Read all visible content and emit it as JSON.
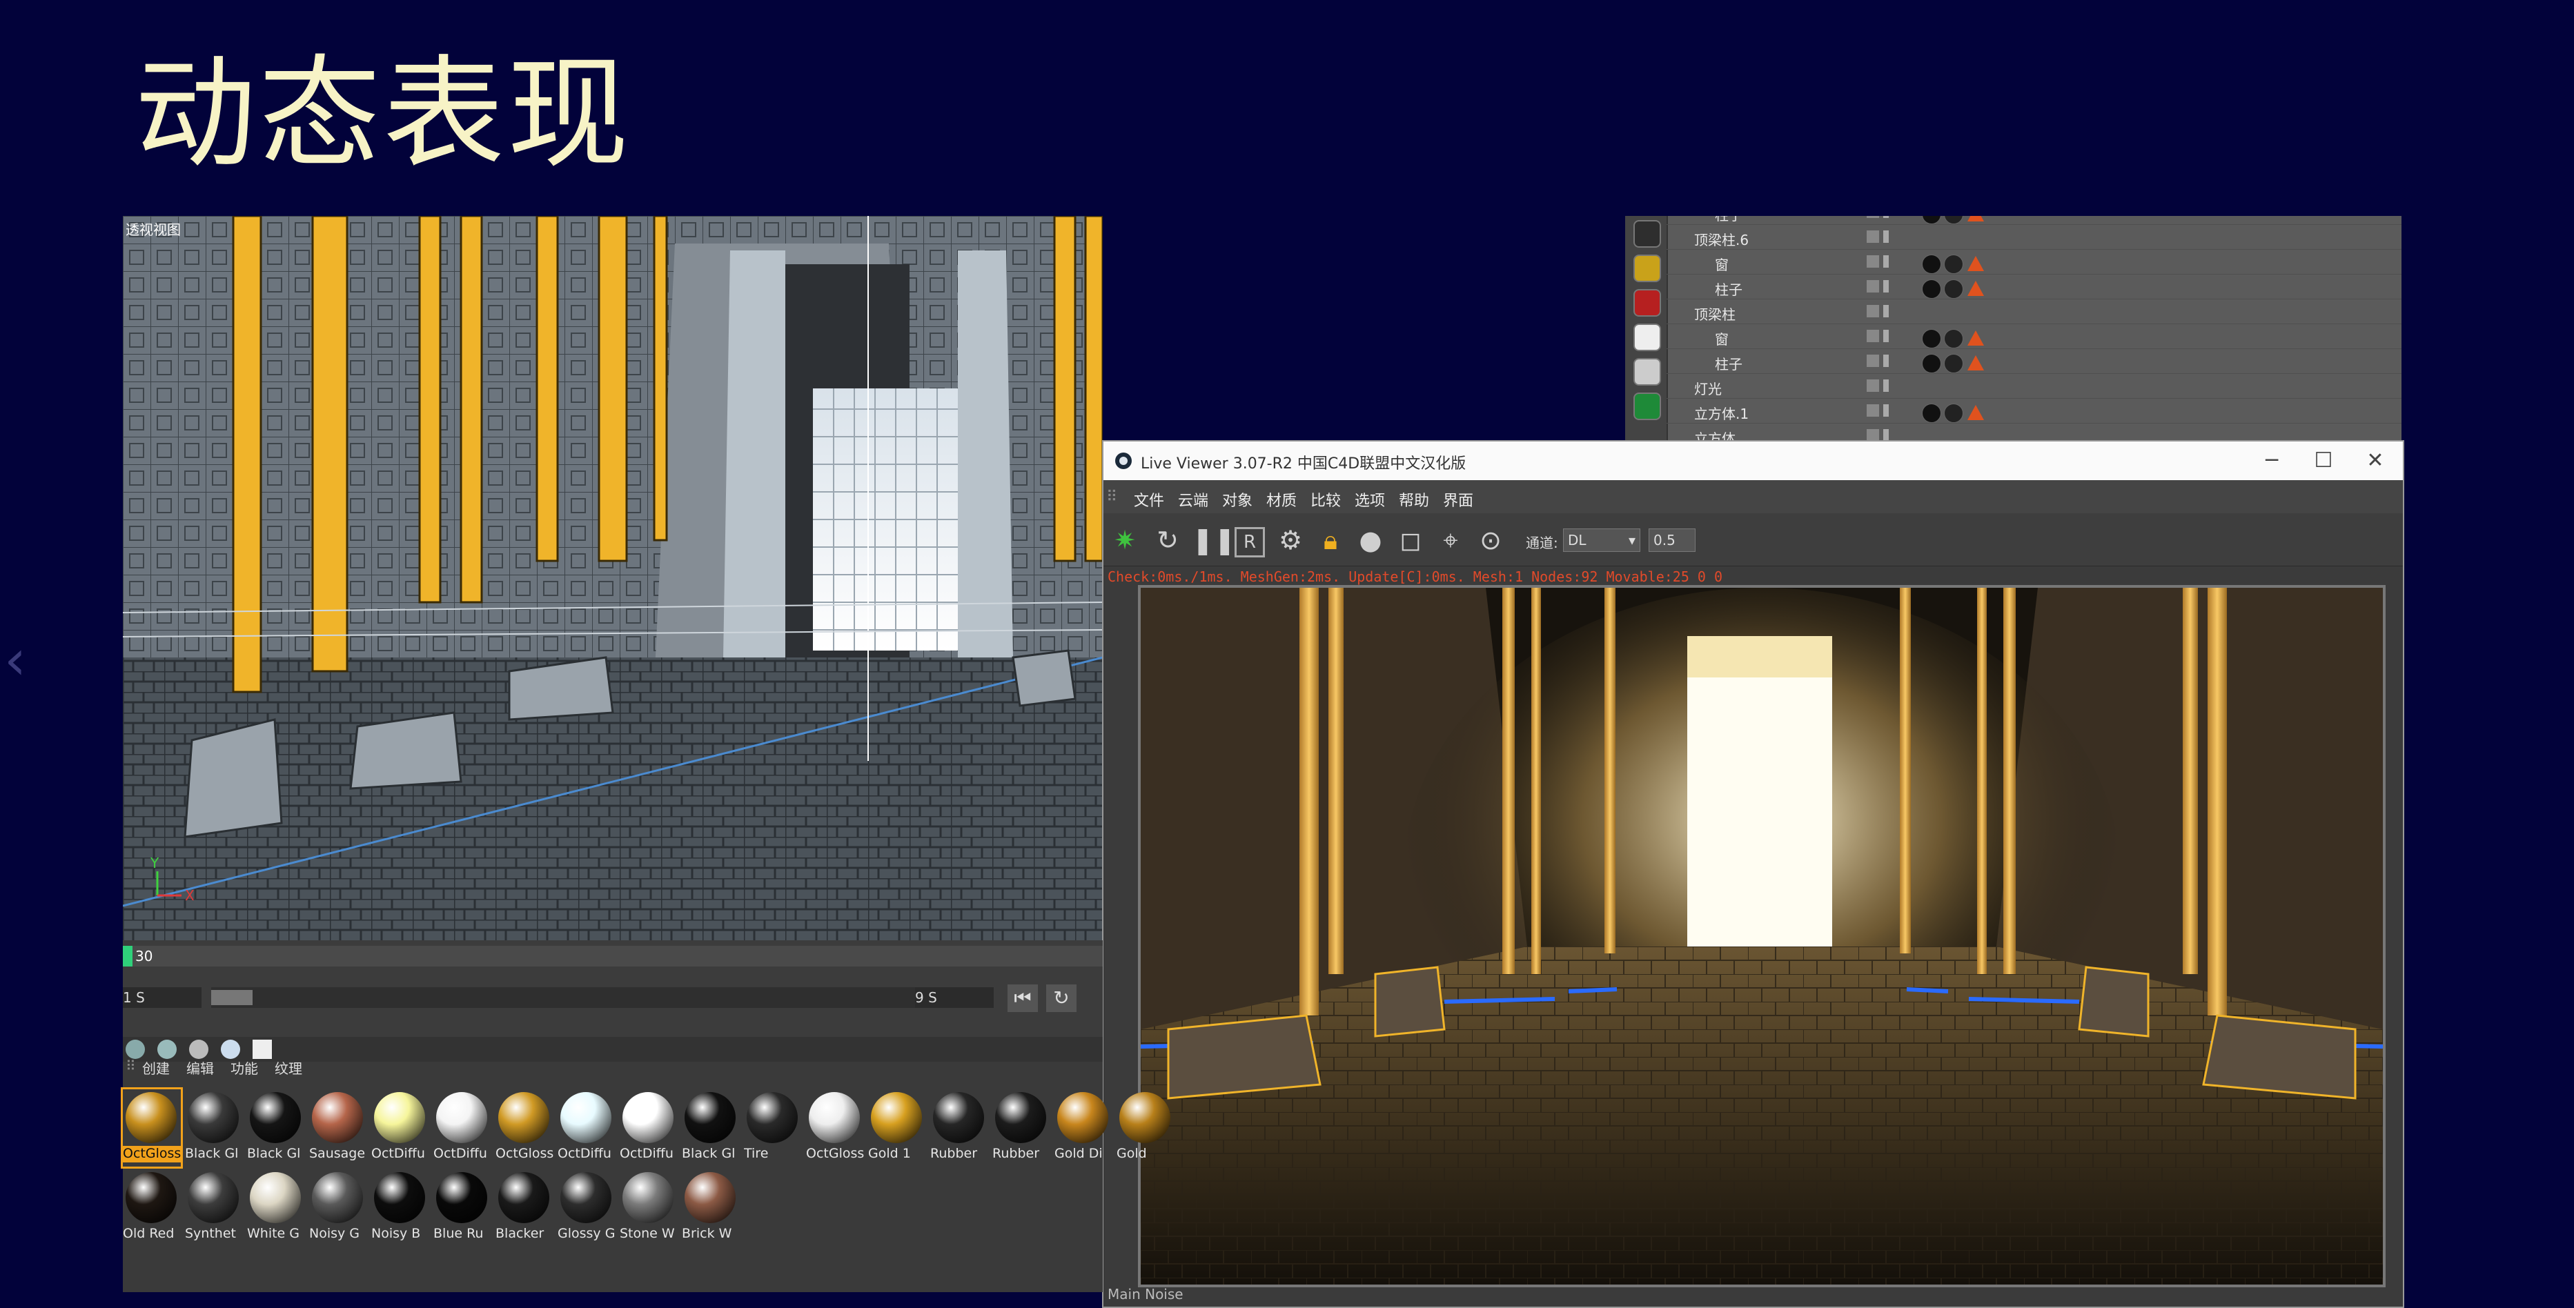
{
  "slide": {
    "title": "动态表现",
    "prev_arrow": "‹"
  },
  "viewport": {
    "label": "透视视图",
    "axis_y": "Y",
    "axis_x": "X"
  },
  "object_manager": {
    "rows": [
      {
        "indent": 1,
        "name": "柱子",
        "has_tags": true
      },
      {
        "indent": 0,
        "name": "顶梁柱.6",
        "has_tags": false
      },
      {
        "indent": 1,
        "name": "窗",
        "has_tags": true
      },
      {
        "indent": 1,
        "name": "柱子",
        "has_tags": true
      },
      {
        "indent": 0,
        "name": "顶梁柱",
        "has_tags": false
      },
      {
        "indent": 1,
        "name": "窗",
        "has_tags": true
      },
      {
        "indent": 1,
        "name": "柱子",
        "has_tags": true
      },
      {
        "indent": 0,
        "name": "灯光",
        "has_tags": false
      },
      {
        "indent": 0,
        "name": "立方体.1",
        "has_tags": true
      },
      {
        "indent": 0,
        "name": "立方体",
        "has_tags": false
      }
    ]
  },
  "live_viewer": {
    "title": "Live Viewer 3.07-R2 中国C4D联盟中文汉化版",
    "window_buttons": {
      "minimize": "─",
      "maximize": "☐",
      "close": "✕"
    },
    "menu": [
      "文件",
      "云端",
      "对象",
      "材质",
      "比较",
      "选项",
      "帮助",
      "界面"
    ],
    "channel_label": "通道:",
    "channel_value": "DL",
    "channel_factor": "0.5",
    "status": "Check:0ms./1ms. MeshGen:2ms. Update[C]:0ms. Mesh:1 Nodes:92 Movable:25  0 0",
    "bottom_status": "Main Noise"
  },
  "timeline": {
    "current_frame": "30",
    "start_value": "1 S",
    "end_value": "9 S"
  },
  "material_manager": {
    "tabs": [
      "创建",
      "编辑",
      "功能",
      "纹理"
    ],
    "row1": [
      {
        "name": "OctGloss",
        "color": "#c8901e"
      },
      {
        "name": "Black Gl",
        "color": "#3a3a3a"
      },
      {
        "name": "Black Gl",
        "color": "#151515"
      },
      {
        "name": "Sausage",
        "color": "#b5654a"
      },
      {
        "name": "OctDiffu",
        "color": "#f6f59b"
      },
      {
        "name": "OctDiffu",
        "color": "#f4f4f4"
      },
      {
        "name": "OctGloss",
        "color": "#d09a25"
      },
      {
        "name": "OctDiffu",
        "color": "#e8fbff"
      },
      {
        "name": "OctDiffu",
        "color": "#ffffff"
      },
      {
        "name": "Black Gl",
        "color": "#111111"
      },
      {
        "name": "Tire",
        "color": "#2a2a2a"
      },
      {
        "name": "OctGloss",
        "color": "#eeeeee"
      },
      {
        "name": "Gold 1",
        "color": "#d7a020"
      },
      {
        "name": "Rubber",
        "color": "#262626"
      },
      {
        "name": "Rubber",
        "color": "#1c1c1c"
      },
      {
        "name": "Gold Di",
        "color": "#c8861d"
      },
      {
        "name": "Gold",
        "color": "#b8801a"
      }
    ],
    "row2": [
      {
        "name": "Old Red",
        "color": "#1e1712"
      },
      {
        "name": "Synthet",
        "color": "#3d3d3d"
      },
      {
        "name": "White G",
        "color": "#dcd6c4"
      },
      {
        "name": "Noisy G",
        "color": "#5a5a5a"
      },
      {
        "name": "Noisy B",
        "color": "#0d0d0d"
      },
      {
        "name": "Blue Ru",
        "color": "#090909"
      },
      {
        "name": "Blacker",
        "color": "#1a1a1a"
      },
      {
        "name": "Glossy G",
        "color": "#2d2d2d"
      },
      {
        "name": "Stone W",
        "color": "#7b7b7b"
      },
      {
        "name": "Brick W",
        "color": "#8c5a45"
      }
    ]
  },
  "colors": {
    "slide_bg": "#02023a",
    "title": "#f7f3c6",
    "pillar_gold": "#f0b42a",
    "status_red": "#e24a2a",
    "neon_blue": "#2a6bff"
  }
}
